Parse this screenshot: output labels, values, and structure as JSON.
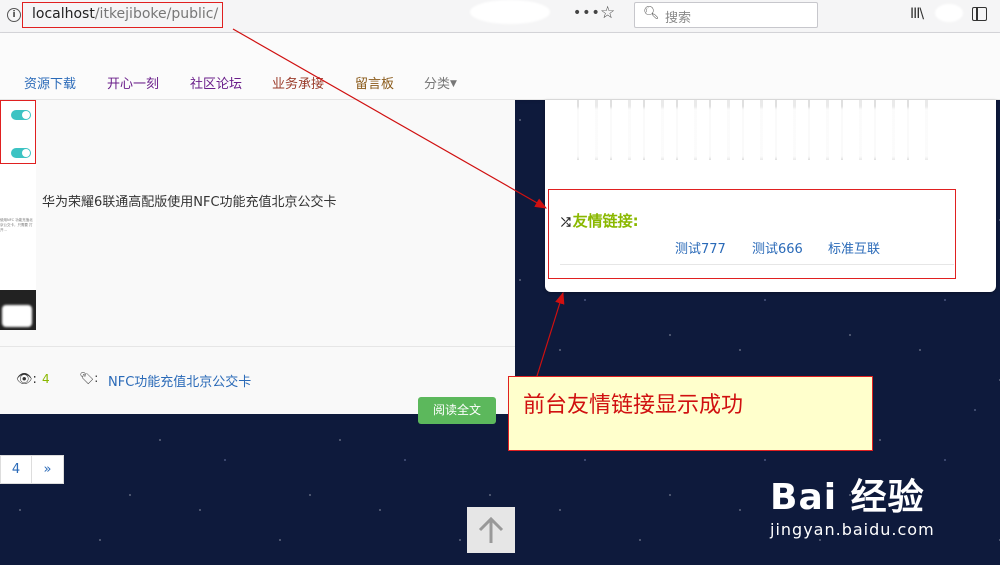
{
  "browser": {
    "url_host": "localhost",
    "url_path": "/itkejiboke/public/",
    "page_actions": "•••",
    "search_placeholder": "搜索"
  },
  "nav": {
    "items": [
      {
        "label": "资源下载"
      },
      {
        "label": "开心一刻"
      },
      {
        "label": "社区论坛"
      },
      {
        "label": "业务承接"
      },
      {
        "label": "留言板"
      },
      {
        "label": "分类"
      }
    ]
  },
  "article": {
    "title": "华为荣耀6联通高配版使用NFC功能充值北京公交卡",
    "views": "4",
    "tag": "NFC功能充值北京公交卡",
    "read_more": "阅读全文",
    "thumb_text": "使用NFC 功能充值北京公交卡，只需要 打开..."
  },
  "pagination": {
    "current": "4",
    "next": "»"
  },
  "friend_links": {
    "heading": "友情链接:",
    "links": [
      {
        "label": "测试777"
      },
      {
        "label": "测试666"
      },
      {
        "label": "标准互联"
      }
    ]
  },
  "annotation": {
    "text": "前台友情链接显示成功"
  },
  "watermark": {
    "logo": "Bai 经验",
    "url": "jingyan.baidu.com"
  },
  "colors": {
    "accent_green": "#8ab800",
    "link_blue": "#2a6ab8",
    "annotation_red": "#e02020",
    "button_green": "#5cb85c"
  }
}
